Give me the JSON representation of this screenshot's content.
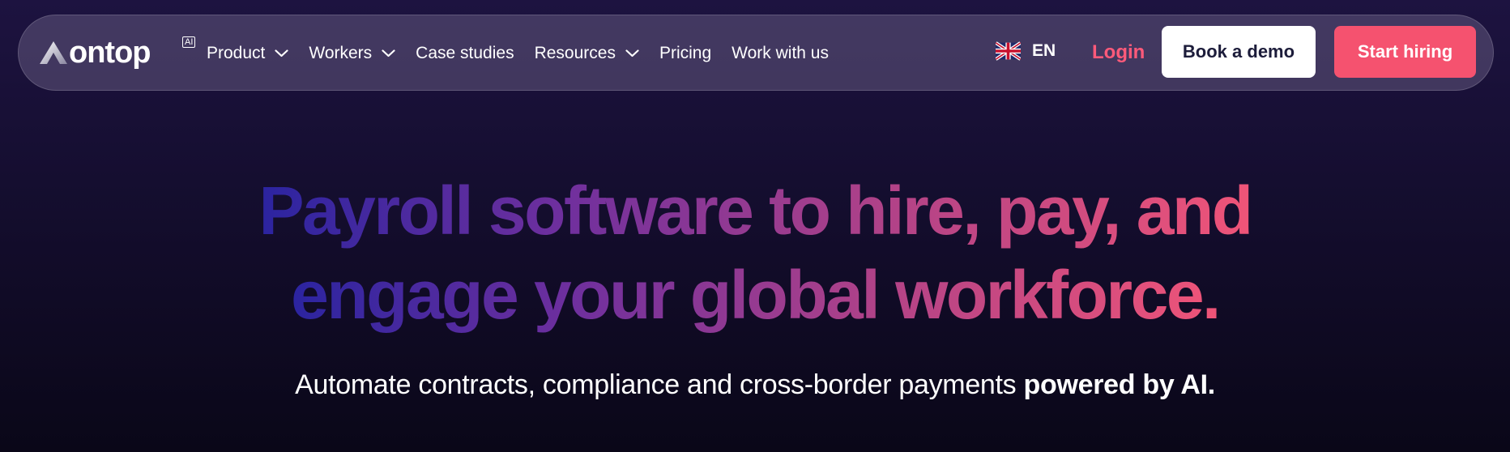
{
  "header": {
    "logo": {
      "text": "ontop",
      "badge": "AI"
    },
    "nav": [
      {
        "label": "Product",
        "has_dropdown": true
      },
      {
        "label": "Workers",
        "has_dropdown": true
      },
      {
        "label": "Case studies",
        "has_dropdown": false
      },
      {
        "label": "Resources",
        "has_dropdown": true
      },
      {
        "label": "Pricing",
        "has_dropdown": false
      },
      {
        "label": "Work with us",
        "has_dropdown": false
      }
    ],
    "language": {
      "code": "EN",
      "flag_icon": "uk-flag-icon"
    },
    "login_label": "Login",
    "demo_label": "Book a demo",
    "start_label": "Start hiring"
  },
  "hero": {
    "title_line1": "Payroll software to hire, pay, and",
    "title_line2": "engage your global workforce.",
    "subtitle_prefix": "Automate contracts, compliance and cross-border payments ",
    "subtitle_bold": "powered by AI."
  },
  "colors": {
    "background": "#150e30",
    "accent": "#f5526f",
    "login_text": "#ff5a7a",
    "gradient_start": "#2b24a0",
    "gradient_end": "#ef5478"
  }
}
